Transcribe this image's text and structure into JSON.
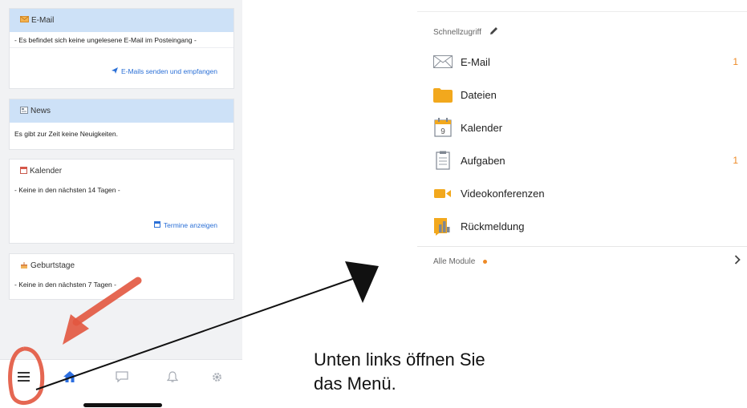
{
  "dashboard": {
    "email_card": {
      "title": "E-Mail",
      "message": "- Es befindet sich keine ungelesene E-Mail im Posteingang -",
      "link": "E-Mails senden und empfangen"
    },
    "news_card": {
      "title": "News",
      "message": "Es gibt zur Zeit keine Neuigkeiten."
    },
    "calendar_card": {
      "title": "Kalender",
      "message": "- Keine in den nächsten 14 Tagen -",
      "link": "Termine anzeigen"
    },
    "birthdays_card": {
      "title": "Geburtstage",
      "message": "- Keine in den nächsten 7 Tagen -"
    },
    "colors": {
      "header_blue": "#cde1f7",
      "link_blue": "#2a6fd6",
      "annotation_red": "#e2563f"
    }
  },
  "bottom_nav": {
    "items": [
      "menu-icon",
      "home-icon",
      "chat-icon",
      "bell-icon",
      "gear-icon"
    ],
    "active": "home-icon"
  },
  "menu": {
    "quick_access": "Schnellzugriff",
    "items": [
      {
        "label": "E-Mail",
        "icon": "envelope-icon",
        "count": "1"
      },
      {
        "label": "Dateien",
        "icon": "folder-icon",
        "count": ""
      },
      {
        "label": "Kalender",
        "icon": "calendar-icon",
        "count": ""
      },
      {
        "label": "Aufgaben",
        "icon": "clipboard-icon",
        "count": "1"
      },
      {
        "label": "Videokonferenzen",
        "icon": "video-camera-icon",
        "count": ""
      },
      {
        "label": "Rückmeldung",
        "icon": "feedback-icon",
        "count": ""
      }
    ],
    "all_modules": "Alle Module",
    "accent": "#ee8a26"
  },
  "caption": {
    "line1": "Unten links öffnen Sie",
    "line2": "das Menü."
  }
}
